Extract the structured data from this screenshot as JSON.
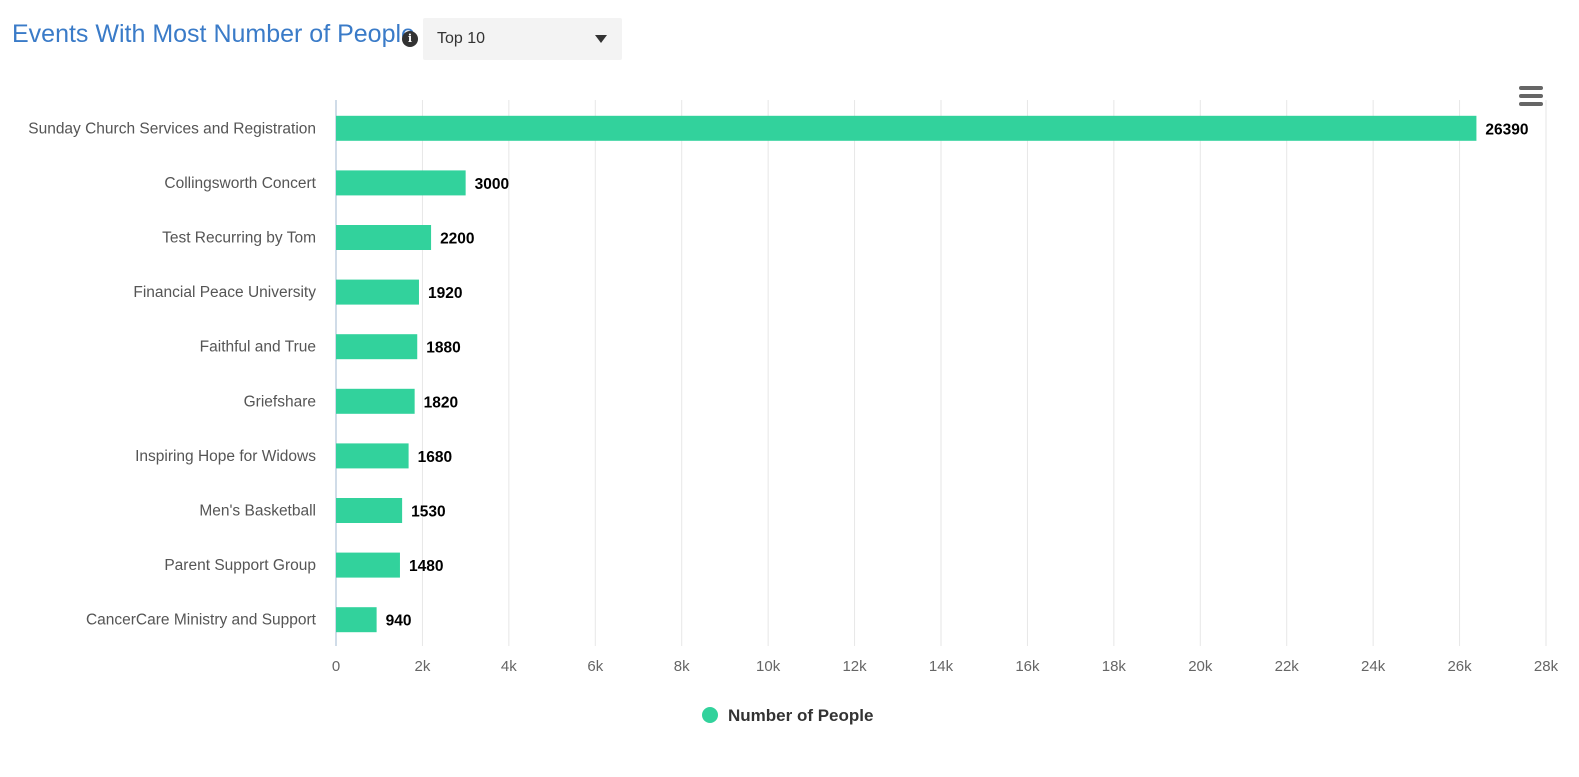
{
  "header": {
    "title": "Events With Most Number of People",
    "info_icon": "info-icon",
    "select": {
      "value": "Top 10"
    }
  },
  "toolbar": {
    "menu_icon": "hamburger-menu-icon"
  },
  "colors": {
    "bar": "#32d29c",
    "title": "#3a7bc8",
    "grid": "#e6e6e6",
    "axis_line": "#c0d0e0"
  },
  "chart_data": {
    "type": "bar",
    "orientation": "horizontal",
    "categories": [
      "Sunday Church Services and Registration",
      "Collingsworth Concert",
      "Test Recurring by Tom",
      "Financial Peace University",
      "Faithful and True",
      "Griefshare",
      "Inspiring Hope for Widows",
      "Men's Basketball",
      "Parent Support Group",
      "CancerCare Ministry and Support"
    ],
    "series": [
      {
        "name": "Number of People",
        "values": [
          26390,
          3000,
          2200,
          1920,
          1880,
          1820,
          1680,
          1530,
          1480,
          940
        ]
      }
    ],
    "x_ticks": [
      "0",
      "2k",
      "4k",
      "6k",
      "8k",
      "10k",
      "12k",
      "14k",
      "16k",
      "18k",
      "20k",
      "22k",
      "24k",
      "26k",
      "28k"
    ],
    "xlim": [
      0,
      28000
    ],
    "grid": true,
    "data_labels": true,
    "legend": {
      "position": "bottom-center",
      "label": "Number of People"
    }
  }
}
